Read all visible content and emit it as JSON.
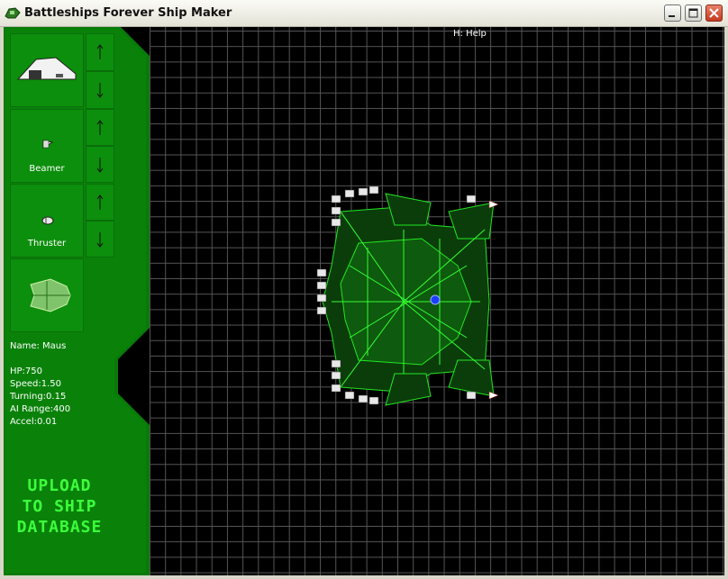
{
  "window": {
    "title": "Battleships Forever Ship Maker"
  },
  "slots": [
    {
      "label": ""
    },
    {
      "label": "Beamer"
    },
    {
      "label": "Thruster"
    },
    {
      "label": ""
    }
  ],
  "ship_stats": {
    "name": "Name: Maus",
    "hp": "HP:750",
    "speed": "Speed:1.50",
    "turning": "Turning:0.15",
    "ai_range": "AI Range:400",
    "accel": "Accel:0.01"
  },
  "upload_button": {
    "lines": [
      "UPLOAD",
      "TO SHIP",
      "DATABASE"
    ]
  },
  "help_hint": "H: Help",
  "colors": {
    "panel_green": "#0c8f0c",
    "panel_dark": "#0a6e0a",
    "grid_line": "#555555",
    "accent_text": "#3cff3c"
  }
}
